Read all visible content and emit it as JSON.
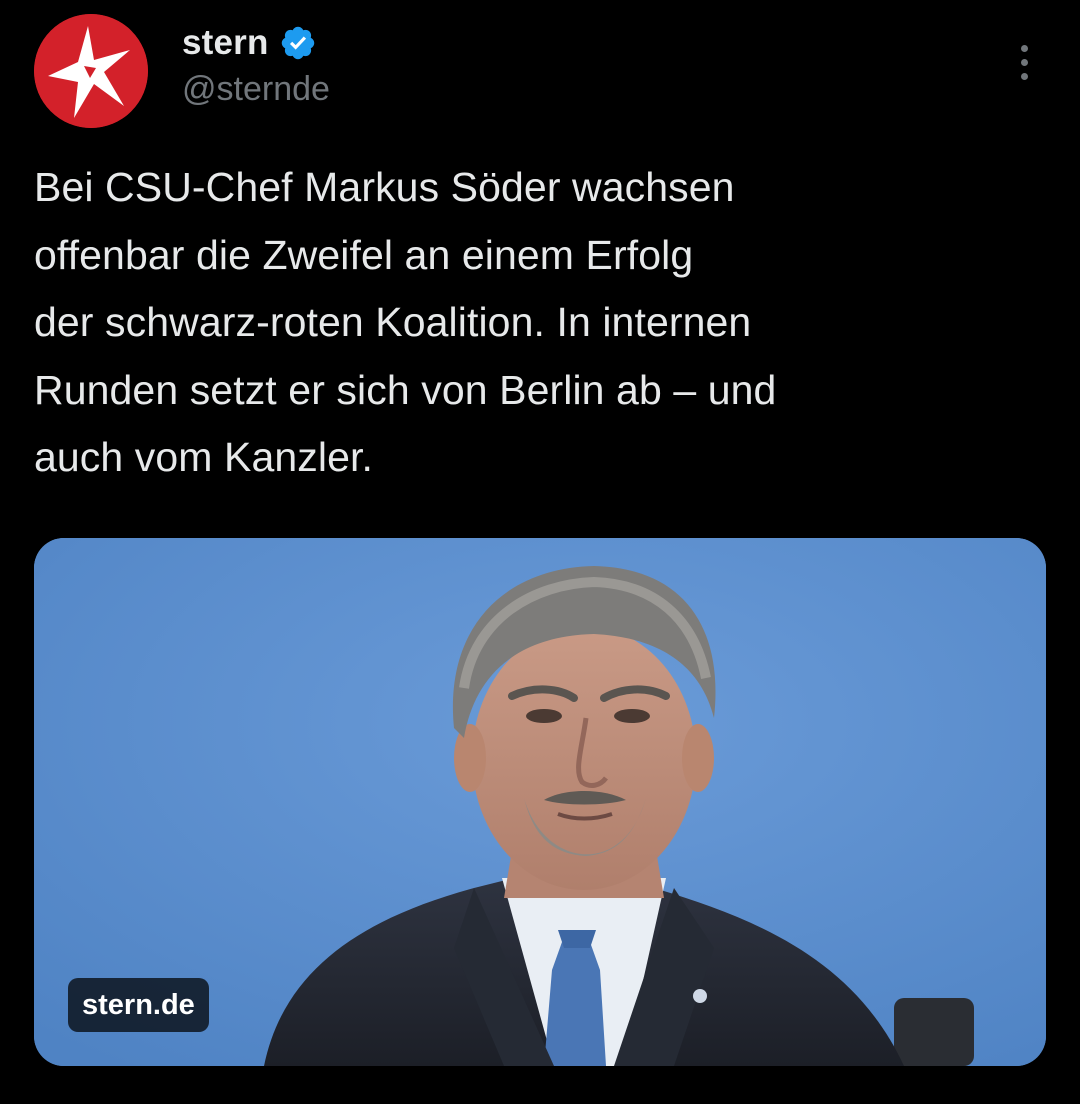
{
  "account": {
    "display_name": "stern",
    "handle": "@sternde",
    "verified": true,
    "avatar_icon": "stern-star-logo",
    "brand_color": "#d3212a",
    "verified_color": "#1d9bf0"
  },
  "tweet": {
    "text": "Bei CSU-Chef Markus Söder wachsen\noffenbar die Zweifel an einem Erfolg\nder schwarz-roten Koalition. In internen\nRunden setzt er sich von Berlin ab – und\nauch vom Kanzler."
  },
  "media": {
    "source_label": "stern.de",
    "background_color": "#5b8fd0"
  },
  "icons": {
    "more": "more-vertical-icon",
    "verified": "verified-badge-icon"
  }
}
